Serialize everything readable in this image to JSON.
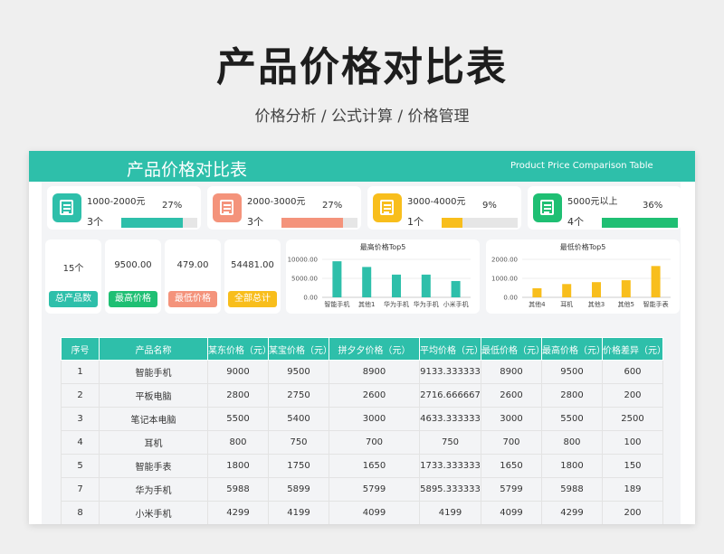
{
  "header": {
    "title": "产品价格对比表",
    "subtitle": "价格分析 /  公式计算 /  价格管理"
  },
  "banner": {
    "title": "产品价格对比表",
    "subtitle_en": "Product Price Comparison Table"
  },
  "range_cards": [
    {
      "range": "1000-2000元",
      "count": "3个",
      "percent": "27%",
      "fraction": 0.27,
      "color": "#2ebfaa",
      "icon": "document-icon"
    },
    {
      "range": "2000-3000元",
      "count": "3个",
      "percent": "27%",
      "fraction": 0.27,
      "color": "#f4937b",
      "icon": "document-icon"
    },
    {
      "range": "3000-4000元",
      "count": "1个",
      "percent": "9%",
      "fraction": 0.09,
      "color": "#f8be1c",
      "icon": "document-icon"
    },
    {
      "range": "5000元以上",
      "count": "4个",
      "percent": "36%",
      "fraction": 0.36,
      "color": "#1fbf73",
      "icon": "document-icon"
    }
  ],
  "stats": [
    {
      "value": "15个",
      "label": "总产品数",
      "color": "#2ebfaa"
    },
    {
      "value": "9500.00",
      "label": "最高价格",
      "color": "#1fbf73"
    },
    {
      "value": "479.00",
      "label": "最低价格",
      "color": "#f4937b"
    },
    {
      "value": "54481.00",
      "label": "全部总计",
      "color": "#f8be1c"
    }
  ],
  "chart_data": [
    {
      "type": "bar",
      "title": "最高价格Top5",
      "categories": [
        "智能手机",
        "其他1",
        "华为手机",
        "华为手机",
        "小米手机"
      ],
      "values": [
        9500,
        8000,
        5988,
        5988,
        4299
      ],
      "yticks": [
        "0.00",
        "5000.00",
        "10000.00"
      ],
      "ylim": [
        0,
        10000
      ],
      "color": "#2ebfaa",
      "grid": true
    },
    {
      "type": "bar",
      "title": "最低价格Top5",
      "categories": [
        "其他4",
        "耳机",
        "其他3",
        "其他5",
        "智能手表"
      ],
      "values": [
        479,
        700,
        800,
        900,
        1650
      ],
      "yticks": [
        "0.00",
        "1000.00",
        "2000.00"
      ],
      "ylim": [
        0,
        2000
      ],
      "color": "#f8be1c",
      "grid": true
    }
  ],
  "table": {
    "headers": [
      "序号",
      "产品名称",
      "某东价格（元）",
      "某宝价格（元）",
      "拼夕夕价格（元）",
      "平均价格（元）",
      "最低价格（元）",
      "最高价格（元）",
      "价格差异（元）"
    ],
    "rows": [
      [
        "1",
        "智能手机",
        "9000",
        "9500",
        "8900",
        "9133.333333",
        "8900",
        "9500",
        "600"
      ],
      [
        "2",
        "平板电脑",
        "2800",
        "2750",
        "2600",
        "2716.666667",
        "2600",
        "2800",
        "200"
      ],
      [
        "3",
        "笔记本电脑",
        "5500",
        "5400",
        "3000",
        "4633.333333",
        "3000",
        "5500",
        "2500"
      ],
      [
        "4",
        "耳机",
        "800",
        "750",
        "700",
        "750",
        "700",
        "800",
        "100"
      ],
      [
        "5",
        "智能手表",
        "1800",
        "1750",
        "1650",
        "1733.333333",
        "1650",
        "1800",
        "150"
      ],
      [
        "7",
        "华为手机",
        "5988",
        "5899",
        "5799",
        "5895.333333",
        "5799",
        "5988",
        "189"
      ],
      [
        "8",
        "小米手机",
        "4299",
        "4199",
        "4099",
        "4199",
        "4099",
        "4299",
        "200"
      ]
    ]
  }
}
